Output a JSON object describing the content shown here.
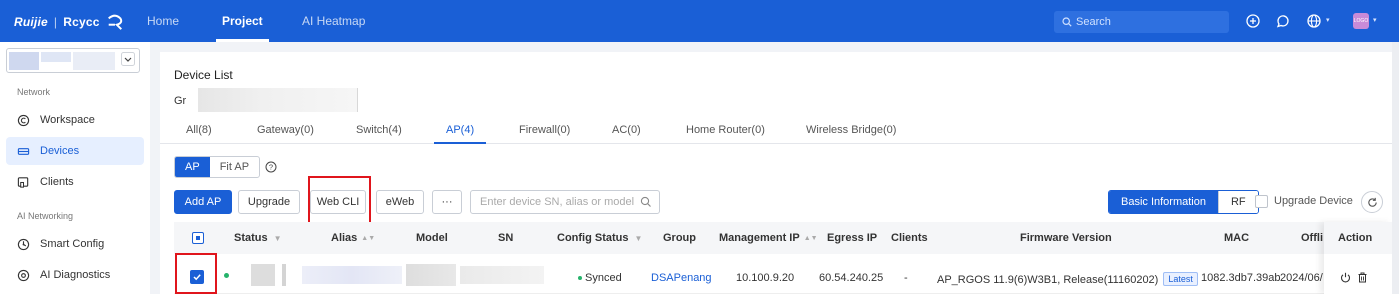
{
  "topbar": {
    "logo_text": "Ruijie",
    "logo_sub": "Rcycc",
    "nav": [
      "Home",
      "Project",
      "AI Heatmap"
    ],
    "active_nav": "Project",
    "search_placeholder": "Search",
    "avatar_text": "LOGO",
    "colors": {
      "bar": "#1a5fd6",
      "search": "#2e70e0"
    }
  },
  "sidebar": {
    "sections": [
      "Network",
      "AI Networking"
    ],
    "items": [
      {
        "label": "Workspace",
        "icon": "workspace-icon"
      },
      {
        "label": "Devices",
        "icon": "devices-icon",
        "active": true
      },
      {
        "label": "Clients",
        "icon": "clients-icon"
      },
      {
        "label": "Smart Config",
        "icon": "smart-config-icon"
      },
      {
        "label": "AI Diagnostics",
        "icon": "ai-diagnostics-icon"
      }
    ]
  },
  "main": {
    "title": "Device List",
    "group_label": "Gr",
    "tabs": [
      "All(8)",
      "Gateway(0)",
      "Switch(4)",
      "AP(4)",
      "Firewall(0)",
      "AC(0)",
      "Home Router(0)",
      "Wireless Bridge(0)"
    ],
    "active_tab": "AP(4)",
    "mode": {
      "options": [
        "AP",
        "Fit AP"
      ],
      "selected": "AP"
    },
    "toolbar": {
      "add": "Add AP",
      "upgrade": "Upgrade",
      "webcli": "Web CLI",
      "eweb": "eWeb",
      "more": "···",
      "search_placeholder": "Enter device SN, alias or model",
      "view_basic": "Basic Information",
      "view_rf": "RF",
      "upgrade_device": "Upgrade Device"
    },
    "table": {
      "headers": [
        "Status",
        "Alias",
        "Model",
        "SN",
        "Config Status",
        "Group",
        "Management IP",
        "Egress IP",
        "Clients",
        "Firmware Version",
        "MAC",
        "Offli",
        "Action"
      ],
      "rows": [
        {
          "config_status": "Synced",
          "group": "DSAPenang",
          "management_ip": "10.100.9.20",
          "egress_ip": "60.54.240.25",
          "clients": "-",
          "firmware": "AP_RGOS 11.9(6)W3B1, Release(11160202)",
          "firmware_badge": "Latest",
          "mac": "1082.3db7.39ab",
          "offline": "2024/06/"
        }
      ]
    }
  },
  "highlight_color": "#e0151c"
}
